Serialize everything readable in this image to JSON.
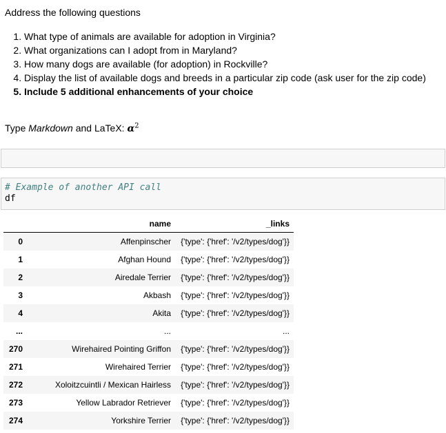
{
  "markdown": {
    "intro": "Address the following questions",
    "questions": [
      "What type of animals are available for adoption in Virginia?",
      "What organizations can I adopt from in Maryland?",
      "How many dogs are available (for adoption) in Rockville?",
      "Display the list of available dogs and breeds in a particular zip code (ask user for the zip code)",
      "Include 5 additional enhancements of your choice"
    ]
  },
  "placeholder_cell": {
    "prefix": "Type ",
    "italic": "Markdown",
    "middle": " and LaTeX: ",
    "math_base": "α",
    "math_sup": "2"
  },
  "code_cell": {
    "comment": "# Example of another API call",
    "code": "df"
  },
  "dataframe": {
    "columns": [
      "name",
      "_links"
    ],
    "ellipsis": "...",
    "rows_head": [
      {
        "index": "0",
        "name": "Affenpinscher",
        "links": "{'type': {'href': '/v2/types/dog'}}"
      },
      {
        "index": "1",
        "name": "Afghan Hound",
        "links": "{'type': {'href': '/v2/types/dog'}}"
      },
      {
        "index": "2",
        "name": "Airedale Terrier",
        "links": "{'type': {'href': '/v2/types/dog'}}"
      },
      {
        "index": "3",
        "name": "Akbash",
        "links": "{'type': {'href': '/v2/types/dog'}}"
      },
      {
        "index": "4",
        "name": "Akita",
        "links": "{'type': {'href': '/v2/types/dog'}}"
      }
    ],
    "rows_tail": [
      {
        "index": "270",
        "name": "Wirehaired Pointing Griffon",
        "links": "{'type': {'href': '/v2/types/dog'}}"
      },
      {
        "index": "271",
        "name": "Wirehaired Terrier",
        "links": "{'type': {'href': '/v2/types/dog'}}"
      },
      {
        "index": "272",
        "name": "Xoloitzcuintli / Mexican Hairless",
        "links": "{'type': {'href': '/v2/types/dog'}}"
      },
      {
        "index": "273",
        "name": "Yellow Labrador Retriever",
        "links": "{'type': {'href': '/v2/types/dog'}}"
      },
      {
        "index": "274",
        "name": "Yorkshire Terrier",
        "links": "{'type': {'href': '/v2/types/dog'}}"
      }
    ]
  }
}
